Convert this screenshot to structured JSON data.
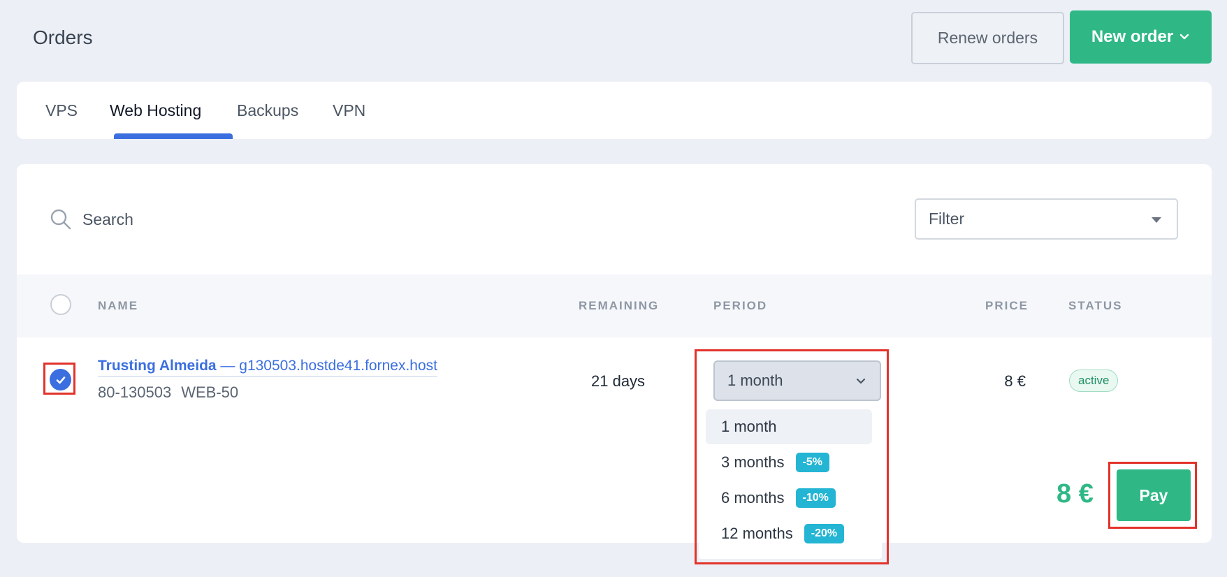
{
  "header": {
    "title": "Orders",
    "renew_label": "Renew orders",
    "new_order_label": "New order"
  },
  "tabs": [
    {
      "label": "VPS"
    },
    {
      "label": "Web Hosting",
      "active": true
    },
    {
      "label": "Backups"
    },
    {
      "label": "VPN"
    }
  ],
  "search": {
    "placeholder": "Search"
  },
  "filter": {
    "label": "Filter"
  },
  "table": {
    "columns": {
      "name": "NAME",
      "remaining": "REMAINING",
      "period": "PERIOD",
      "price": "PRICE",
      "status": "STATUS"
    },
    "row": {
      "name": "Trusting Almeida",
      "separator": " — ",
      "host": "g130503.hostde41.fornex.host",
      "order_id": "80-130503",
      "plan": "WEB-50",
      "remaining": "21 days",
      "period": "1 month",
      "price": "8 €",
      "status": "active"
    }
  },
  "period_options": [
    {
      "label": "1 month",
      "discount": "",
      "selected": true
    },
    {
      "label": "3 months",
      "discount": "-5%"
    },
    {
      "label": "6 months",
      "discount": "-10%"
    },
    {
      "label": "12 months",
      "discount": "-20%"
    }
  ],
  "footer": {
    "total": "8 €",
    "pay_label": "Pay"
  },
  "colors": {
    "accent_green": "#2fb886",
    "accent_blue": "#3b6fe0",
    "discount_badge": "#23b5d3",
    "highlight": "#e2332b"
  }
}
